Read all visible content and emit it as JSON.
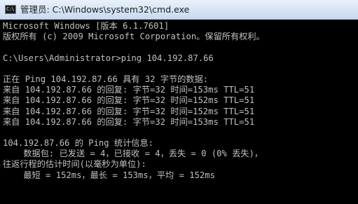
{
  "window": {
    "title": "管理员: C:\\Windows\\system32\\cmd.exe",
    "icon": "cmd-icon",
    "icon_glyph": "C:\\"
  },
  "console": {
    "lines": [
      "Microsoft Windows [版本 6.1.7601]",
      "版权所有 (c) 2009 Microsoft Corporation。保留所有权利。",
      "",
      "C:\\Users\\Administrator>ping 104.192.87.66",
      "",
      "正在 Ping 104.192.87.66 具有 32 字节的数据:",
      "来自 104.192.87.66 的回复: 字节=32 时间=153ms TTL=51",
      "来自 104.192.87.66 的回复: 字节=32 时间=152ms TTL=51",
      "来自 104.192.87.66 的回复: 字节=32 时间=152ms TTL=51",
      "来自 104.192.87.66 的回复: 字节=32 时间=153ms TTL=51",
      "",
      "104.192.87.66 的 Ping 统计信息:",
      "    数据包: 已发送 = 4，已接收 = 4，丢失 = 0 (0% 丢失)，",
      "往返行程的估计时间(以毫秒为单位):",
      "    最短 = 152ms，最长 = 153ms，平均 = 152ms"
    ]
  },
  "colors": {
    "console_background": "#000000",
    "console_text": "#c0c0c0",
    "titlebar": "#d6e3f3"
  }
}
